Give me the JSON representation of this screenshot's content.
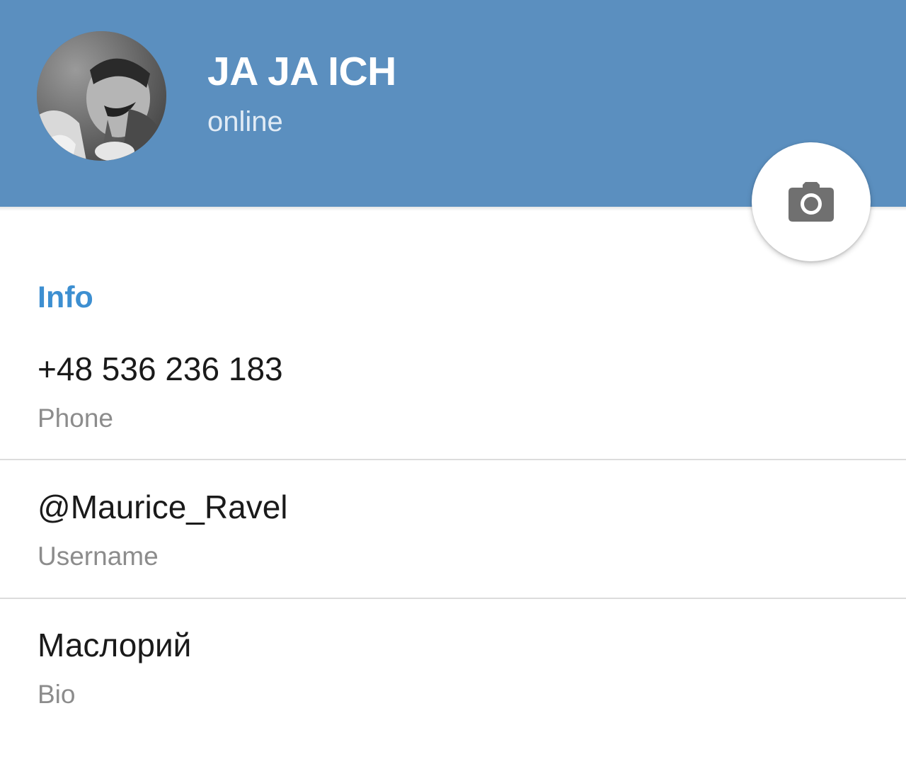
{
  "profile": {
    "name": "JA JA ICH",
    "status": "online"
  },
  "info": {
    "section_title": "Info",
    "rows": [
      {
        "value": "+48 536 236 183",
        "label": "Phone"
      },
      {
        "value": "@Maurice_Ravel",
        "label": "Username"
      },
      {
        "value": "Маслорий",
        "label": "Bio"
      }
    ]
  },
  "icons": {
    "camera": "camera-icon",
    "avatar": "avatar-photo"
  },
  "colors": {
    "header_bg": "#5b8fbf",
    "accent": "#3d8fd1",
    "secondary_text": "#8c8c8c",
    "primary_text": "#1a1a1a"
  }
}
